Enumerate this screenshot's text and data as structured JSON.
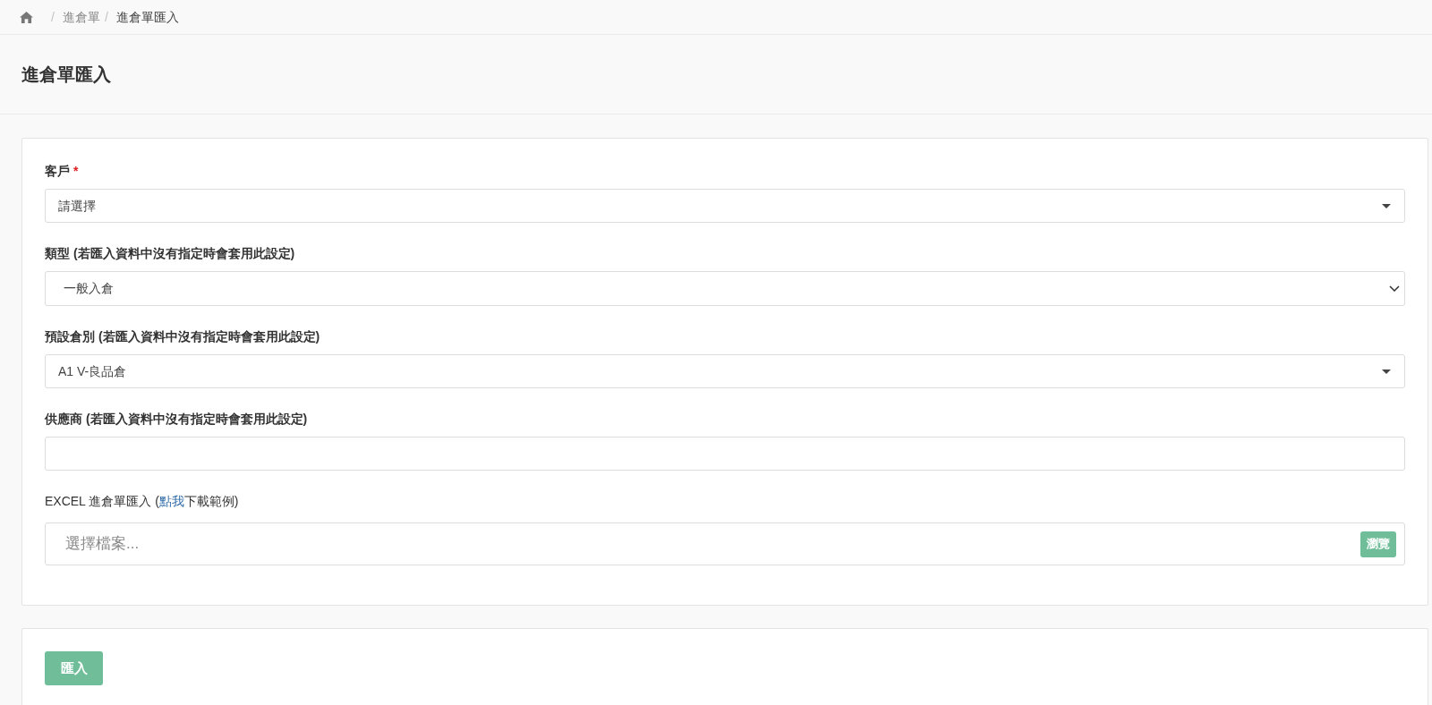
{
  "breadcrumb": {
    "items": [
      {
        "separator": "/",
        "label": "進倉單",
        "current": false
      },
      {
        "separator": "/",
        "label": "進倉單匯入",
        "current": true
      }
    ]
  },
  "page_title": "進倉單匯入",
  "form": {
    "fields": [
      {
        "kind": "select",
        "label": "客戶",
        "required_mark": "*",
        "value": "請選擇"
      },
      {
        "kind": "native_select",
        "label": "類型 (若匯入資料中沒有指定時會套用此設定)",
        "value": "一般入倉"
      },
      {
        "kind": "select",
        "label": "預設倉別 (若匯入資料中沒有指定時會套用此設定)",
        "value": "A1 V-良品倉"
      },
      {
        "kind": "text",
        "label": "供應商 (若匯入資料中沒有指定時會套用此設定)"
      },
      {
        "kind": "file",
        "label_before": "EXCEL 進倉單匯入 (",
        "link": "點我",
        "label_after": "下載範例)",
        "placeholder": "選擇檔案...",
        "button": "瀏覽"
      }
    ]
  },
  "actions": {
    "submit": "匯入"
  }
}
